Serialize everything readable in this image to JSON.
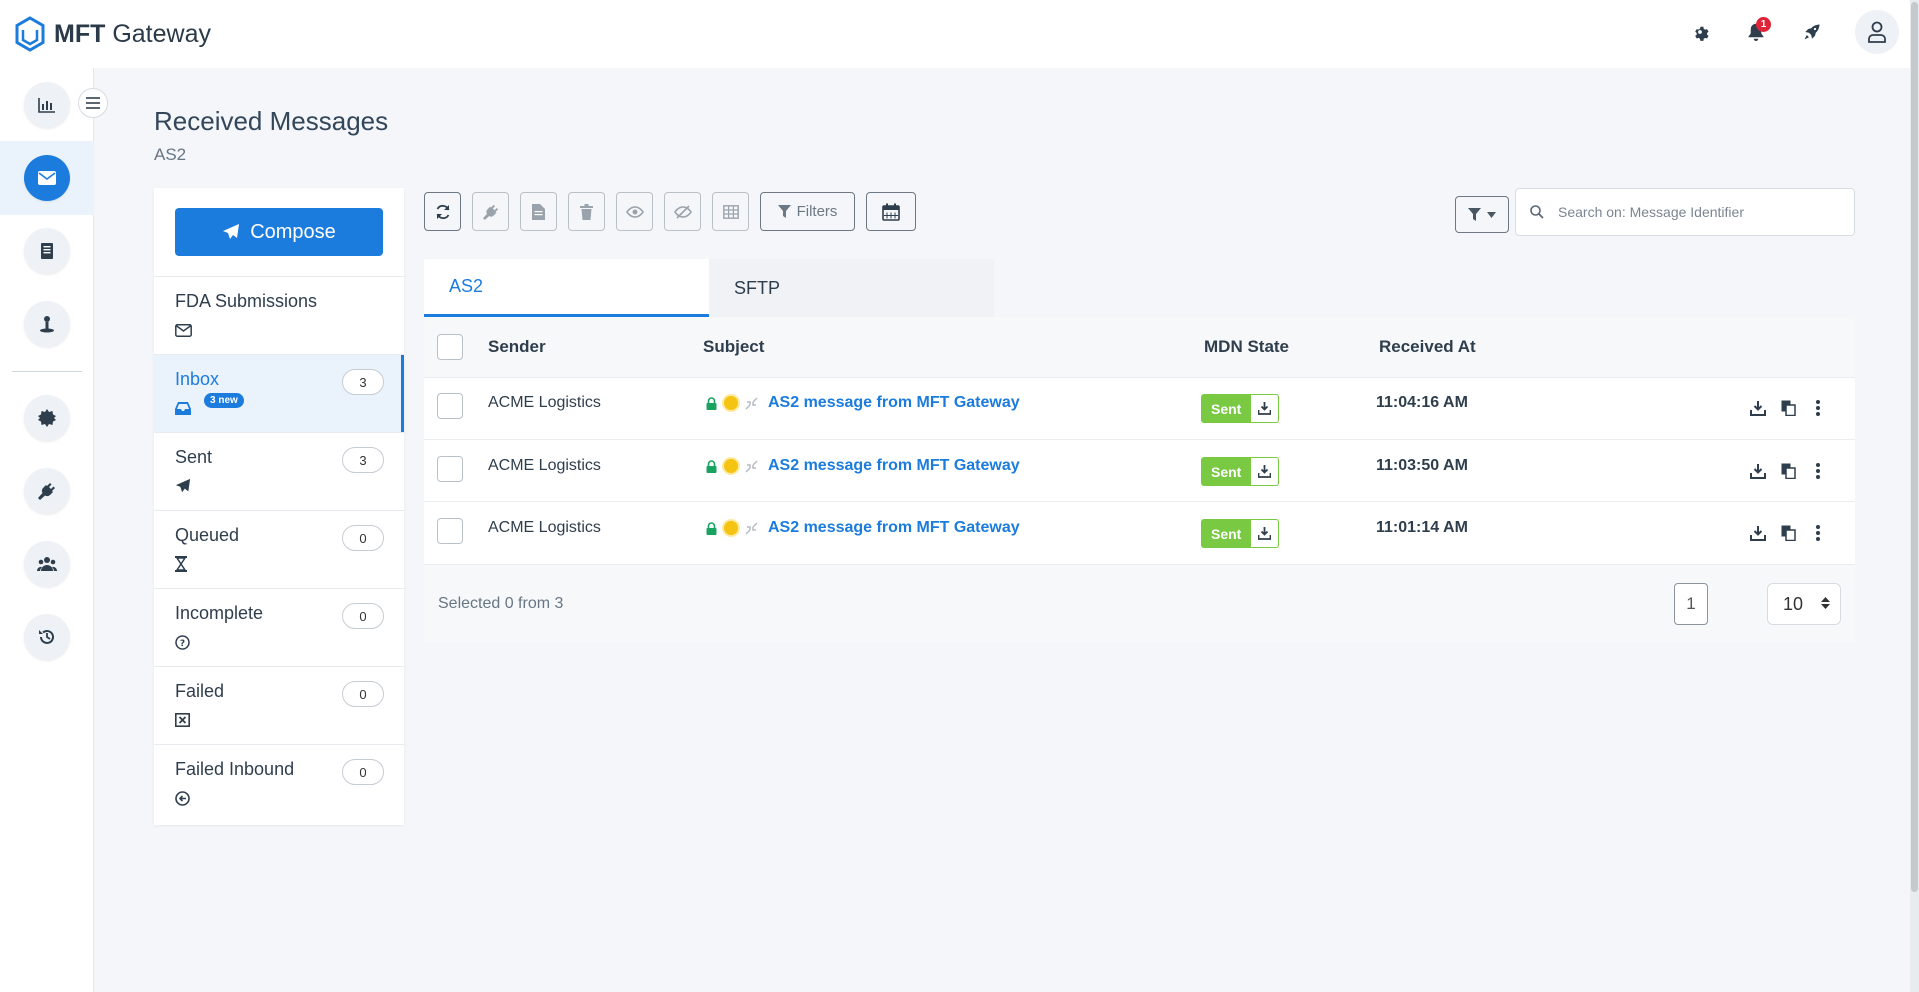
{
  "app": {
    "brand_bold": "MFT",
    "brand_rest": " Gateway",
    "notification_count": "1"
  },
  "colors": {
    "accent": "#1b7cde",
    "sent": "#7ac943",
    "badge": "#e02438"
  },
  "page": {
    "title": "Received Messages",
    "subtitle": "AS2"
  },
  "rail": {
    "items": [
      "dashboard-chart-icon",
      "messages-envelope-icon",
      "documents-icon",
      "partners-icon",
      "certificates-icon",
      "connectors-plug-icon",
      "users-icon",
      "history-icon"
    ],
    "active": "messages-envelope-icon"
  },
  "compose": {
    "label": "Compose"
  },
  "folders": [
    {
      "label": "FDA Submissions",
      "icon": "envelope-icon",
      "count": ""
    },
    {
      "label": "Inbox",
      "icon": "inbox-icon",
      "count": "3",
      "badge": "3 new",
      "active": true
    },
    {
      "label": "Sent",
      "icon": "paper-plane-icon",
      "count": "3"
    },
    {
      "label": "Queued",
      "icon": "hourglass-icon",
      "count": "0"
    },
    {
      "label": "Incomplete",
      "icon": "question-icon",
      "count": "0"
    },
    {
      "label": "Failed",
      "icon": "x-box-icon",
      "count": "0"
    },
    {
      "label": "Failed Inbound",
      "icon": "back-arrow-circle-icon",
      "count": "0"
    }
  ],
  "toolbar": {
    "filters_label": "Filters"
  },
  "search": {
    "placeholder": "Search on: Message Identifier",
    "value": ""
  },
  "tabs": [
    {
      "label": "AS2",
      "active": true
    },
    {
      "label": "SFTP"
    }
  ],
  "table": {
    "headers": {
      "sender": "Sender",
      "subject": "Subject",
      "mdn": "MDN State",
      "received": "Received At"
    },
    "rows": [
      {
        "sender": "ACME Logistics",
        "subject": "AS2 message from MFT Gateway",
        "mdn": "Sent",
        "received": "11:04:16 AM"
      },
      {
        "sender": "ACME Logistics",
        "subject": "AS2 message from MFT Gateway",
        "mdn": "Sent",
        "received": "11:03:50 AM"
      },
      {
        "sender": "ACME Logistics",
        "subject": "AS2 message from MFT Gateway",
        "mdn": "Sent",
        "received": "11:01:14 AM"
      }
    ],
    "footer": {
      "selected": "Selected 0 from 3",
      "page": "1",
      "per_page": "10"
    }
  }
}
